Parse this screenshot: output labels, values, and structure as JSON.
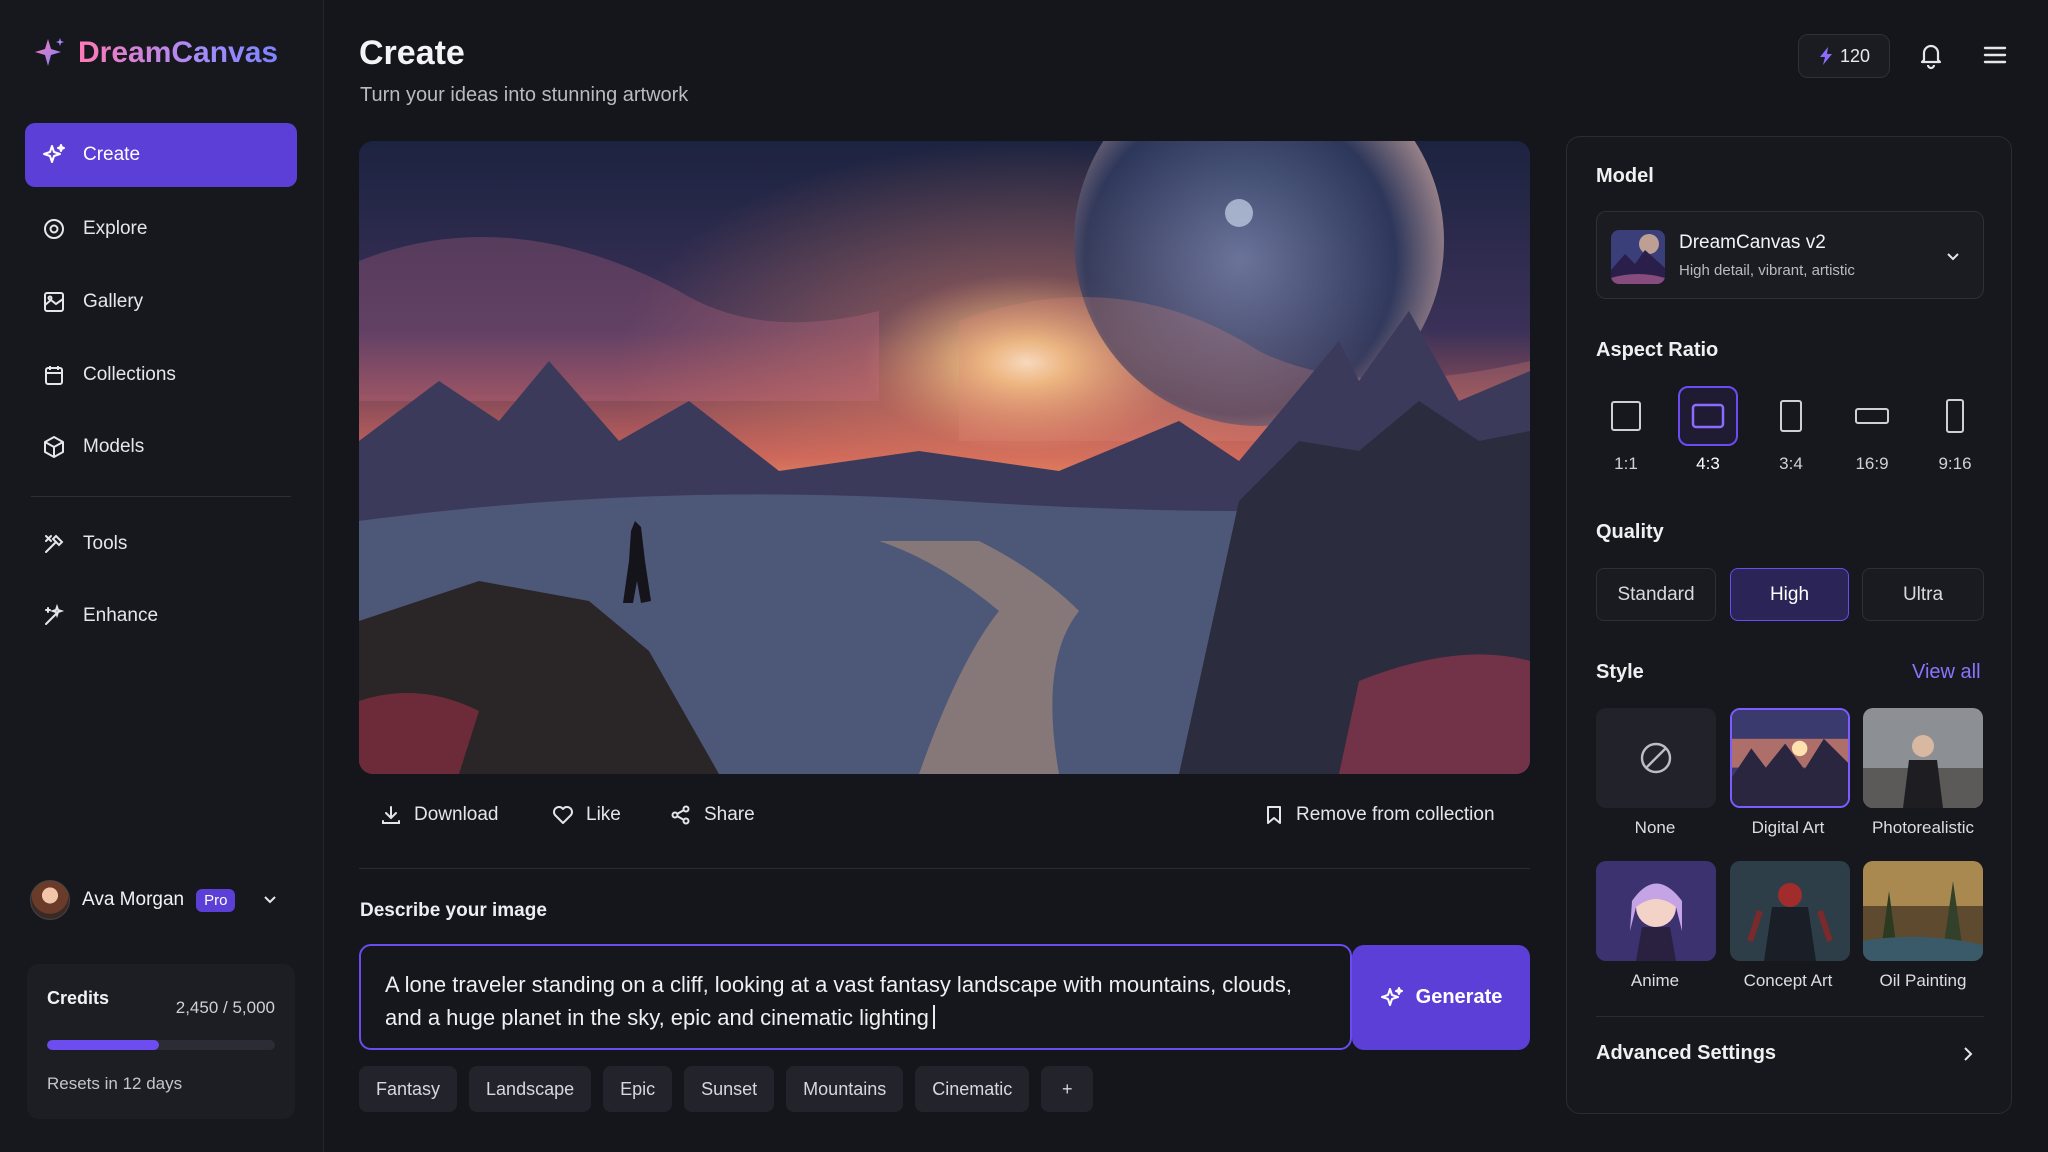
{
  "app": {
    "name": "DreamCanvas"
  },
  "sidebar": {
    "items": [
      {
        "label": "Create",
        "icon": "sparkles-icon",
        "active": true
      },
      {
        "label": "Explore",
        "icon": "compass-icon"
      },
      {
        "label": "Gallery",
        "icon": "image-grid-icon"
      },
      {
        "label": "Collections",
        "icon": "folder-icon"
      },
      {
        "label": "Models",
        "icon": "cube-icon"
      },
      {
        "label": "Tools",
        "icon": "tools-icon"
      },
      {
        "label": "Enhance",
        "icon": "magic-wand-icon"
      }
    ],
    "user": {
      "name": "Ava Morgan",
      "badge": "Pro"
    },
    "credits": {
      "title": "Credits",
      "count": "2,450 / 5,000",
      "fraction": 0.49,
      "reset": "Resets in 12 days"
    }
  },
  "header": {
    "title": "Create",
    "subtitle": "Turn your ideas into stunning artwork",
    "credit_balance": "120"
  },
  "actions": {
    "download": "Download",
    "like": "Like",
    "share": "Share",
    "remove": "Remove from collection"
  },
  "prompt": {
    "label": "Describe your image",
    "text": "A lone traveler standing on a cliff, looking at a vast fantasy landscape with mountains, clouds, and a huge planet in the sky, epic and cinematic lighting",
    "generate": "Generate",
    "tags": [
      "Fantasy",
      "Landscape",
      "Epic",
      "Sunset",
      "Mountains",
      "Cinematic"
    ],
    "add_tag": "+"
  },
  "settings": {
    "model_label": "Model",
    "model": {
      "name": "DreamCanvas v2",
      "desc": "High detail, vibrant, artistic"
    },
    "aspect_label": "Aspect Ratio",
    "ratios": [
      "1:1",
      "4:3",
      "3:4",
      "16:9",
      "9:16"
    ],
    "ratio_selected": "4:3",
    "quality_label": "Quality",
    "qualities": [
      "Standard",
      "High",
      "Ultra"
    ],
    "quality_selected": "High",
    "style_label": "Style",
    "view_all": "View all",
    "styles": [
      "None",
      "Digital Art",
      "Photorealistic",
      "Anime",
      "Concept Art",
      "Oil Painting"
    ],
    "style_selected": "Digital Art",
    "advanced": "Advanced Settings"
  },
  "colors": {
    "accent": "#5b3fd6",
    "accent_border": "#6a4cf0",
    "background": "#15161b"
  }
}
